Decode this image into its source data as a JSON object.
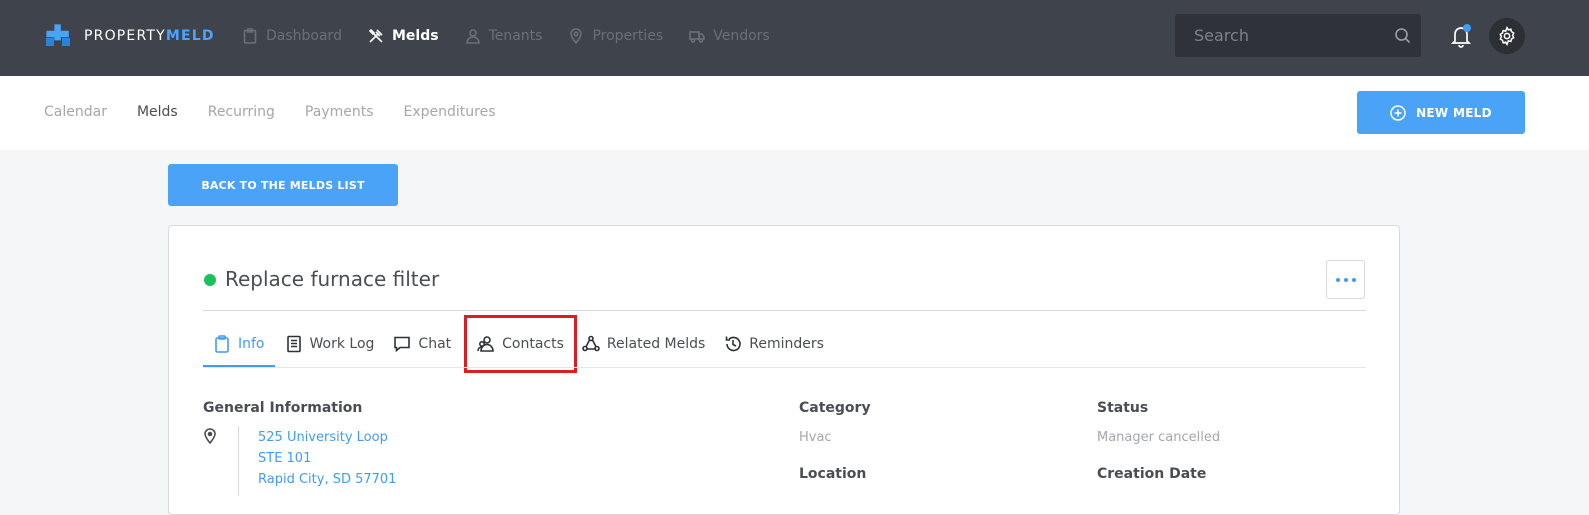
{
  "brand": {
    "name_part1": "PROPERTY",
    "name_part2": "MELD"
  },
  "nav": {
    "items": [
      {
        "label": "Dashboard",
        "icon": "clipboard-icon"
      },
      {
        "label": "Melds",
        "icon": "tools-icon"
      },
      {
        "label": "Tenants",
        "icon": "user-icon"
      },
      {
        "label": "Properties",
        "icon": "map-pin-icon"
      },
      {
        "label": "Vendors",
        "icon": "truck-icon"
      }
    ],
    "active": "Melds"
  },
  "search": {
    "placeholder": "Search",
    "value": ""
  },
  "subnav": {
    "items": [
      "Calendar",
      "Melds",
      "Recurring",
      "Payments",
      "Expenditures"
    ],
    "active": "Melds",
    "new_meld_label": "NEW MELD"
  },
  "back_label": "BACK TO THE MELDS LIST",
  "meld": {
    "title": "Replace furnace filter",
    "status_color": "#1fc05a",
    "tabs": [
      {
        "label": "Info",
        "icon": "clipboard-icon"
      },
      {
        "label": "Work Log",
        "icon": "document-icon"
      },
      {
        "label": "Chat",
        "icon": "chat-bubble-icon"
      },
      {
        "label": "Contacts",
        "icon": "contacts-icon"
      },
      {
        "label": "Related Melds",
        "icon": "related-icon"
      },
      {
        "label": "Reminders",
        "icon": "clock-history-icon"
      }
    ],
    "active_tab": "Info",
    "highlighted_tab": "Contacts",
    "general_info_label": "General Information",
    "address": [
      "525 University Loop",
      "STE 101",
      "Rapid City, SD 57701"
    ],
    "category_label": "Category",
    "category_value": "Hvac",
    "status_label": "Status",
    "status_value": "Manager cancelled",
    "location_label": "Location",
    "creation_date_label": "Creation Date"
  },
  "colors": {
    "accent": "#3f9cf5",
    "topbar": "#3f434b",
    "highlight": "#d91f1f"
  }
}
